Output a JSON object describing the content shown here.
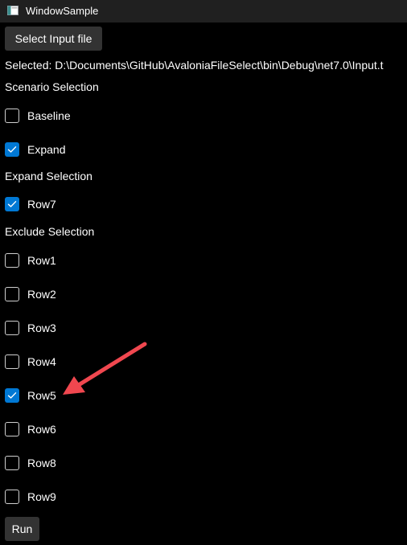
{
  "window": {
    "title": "WindowSample",
    "icon": "window-app-icon"
  },
  "toolbar": {
    "select_input_label": "Select Input file"
  },
  "selected_path_text": "Selected: D:\\Documents\\GitHub\\AvaloniaFileSelect\\bin\\Debug\\net7.0\\Input.t",
  "scenario": {
    "heading": "Scenario Selection",
    "items": [
      {
        "label": "Baseline",
        "checked": false
      },
      {
        "label": "Expand",
        "checked": true
      }
    ]
  },
  "expand": {
    "heading": "Expand Selection",
    "items": [
      {
        "label": "Row7",
        "checked": true
      }
    ]
  },
  "exclude": {
    "heading": "Exclude Selection",
    "items": [
      {
        "label": "Row1",
        "checked": false
      },
      {
        "label": "Row2",
        "checked": false
      },
      {
        "label": "Row3",
        "checked": false
      },
      {
        "label": "Row4",
        "checked": false
      },
      {
        "label": "Row5",
        "checked": true
      },
      {
        "label": "Row6",
        "checked": false
      },
      {
        "label": "Row8",
        "checked": false
      },
      {
        "label": "Row9",
        "checked": false
      }
    ]
  },
  "actions": {
    "run_label": "Run"
  },
  "colors": {
    "background": "#000000",
    "titlebar": "#202020",
    "button": "#333333",
    "check_accent": "#0078d4",
    "annotation_arrow": "#f0474f"
  }
}
